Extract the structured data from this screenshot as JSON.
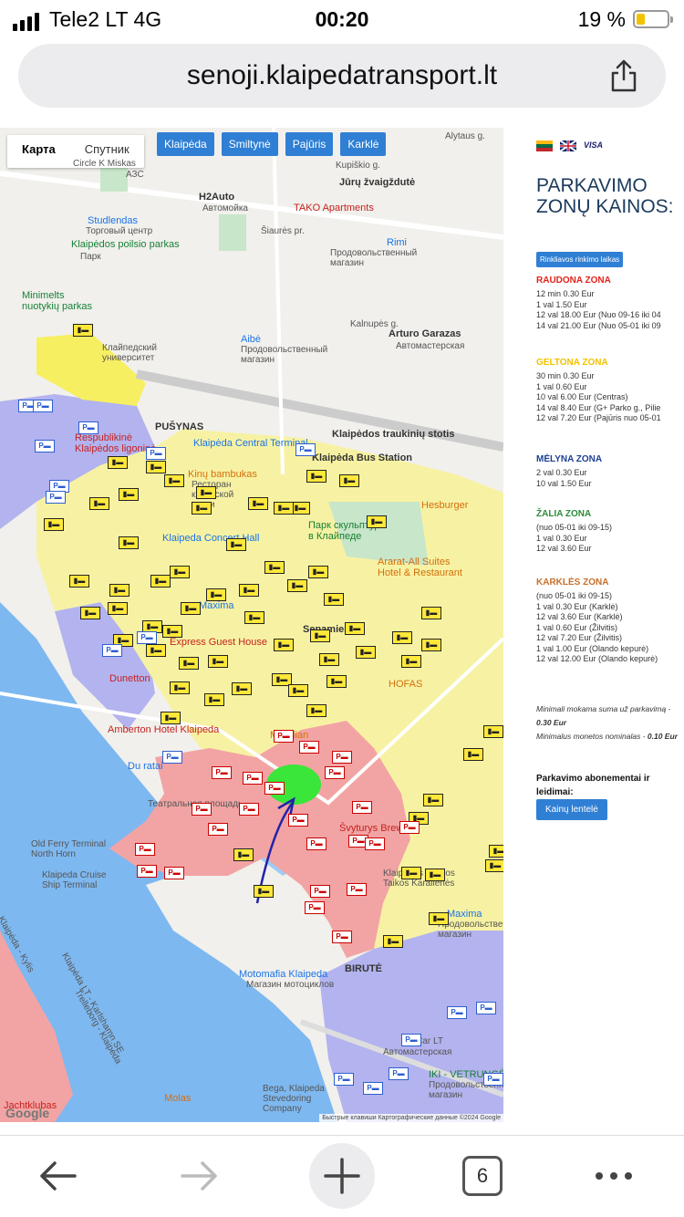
{
  "status": {
    "carrier": "Tele2 LT  4G",
    "time": "00:20",
    "battery": "19 %"
  },
  "browser": {
    "url": "senoji.klaipedatransport.lt",
    "tab_count": "6"
  },
  "map": {
    "map_type": [
      "Карта",
      "Спутник"
    ],
    "areas": [
      "Klaipėda",
      "Smiltynė",
      "Pajūris",
      "Karklė"
    ],
    "labels": {
      "alytaus": "Alytaus g.",
      "kupiskio": "Kupiškio g.",
      "circle": "Circle K Miskas",
      "azs": "АЗС",
      "jurys": "Jūrų žvaigždutė",
      "h2auto": "H2Auto",
      "h2auto_sub": "Автомойка",
      "tako": "TAKO Apartments",
      "siaures": "Šiaurės pr.",
      "studlendas": "Studlendas",
      "studlendas_sub": "Торговый центр",
      "rimi": "Rimi",
      "rimi_sub": "Продовольственный магазин",
      "poilsio": "Klaipėdos poilsio parkas",
      "poilsio_sub": "Парк",
      "minimelts": "Minimelts nuotykių parkas",
      "kalnupes": "Kalnupės g.",
      "arturo": "Arturo Garazas",
      "arturo_sub": "Автомастерская",
      "universitetas": "Клайпедский университет",
      "aibe": "Aibė",
      "aibe_sub": "Продовольственный магазин",
      "pusynas": "PUŠYNAS",
      "respublikine": "Respublikinė Klaipėdos ligoninė",
      "central": "Klaipėda Central Terminal",
      "stotis": "Klaipėdos traukinių stotis",
      "bus": "Klaipėda Bus Station",
      "bambukas": "Kinų bambukas",
      "bambukas_sub": "Ресторан китайской кухни",
      "hesburger": "Hesburger",
      "park": "Парк скульптур в Клайпеде",
      "concert": "Klaipeda Concert Hall",
      "ararat": "Ararat-All Suites Hotel & Restaurant",
      "maxima": "Maxima",
      "senamiestis": "Senamiestis",
      "express": "Express Guest House",
      "dunetton": "Dunetton",
      "amberton": "Amberton Hotel Klaipeda",
      "meridian": "Meridian",
      "hofas": "HOFAS",
      "duratai": "Du ratai",
      "teatro": "Театральная площадь",
      "svyturys": "Švyturys Brewery",
      "oldferry": "Old Ferry Terminal North Horn",
      "cruise": "Klaipeda Cruise Ship Terminal",
      "marijos": "Klaipėdos Marijos Taikos Karalienės",
      "maxima2": "Maxima",
      "maxima2_sub": "Продовольственный магазин",
      "motomafia": "Motomafia Klaipeda",
      "motomafia_sub": "Магазин мотоциклов",
      "birute": "BIRUTĖ",
      "luxcar": "LuxCar LT",
      "luxcar_sub": "Автомастерская",
      "iki": "IKI - VETRUNGĖ",
      "iki_sub": "Продовольственный магазин",
      "molas": "Molas",
      "bega": "Bega, Klaipeda Stevedoring Company",
      "jachtklubas": "Jachtklubas",
      "kylis": "Klaipėda - Kylis",
      "karlshamn": "Klaipėda LT - Karlshamn SE",
      "trelleborg": "Trelleborg - Klaipėda"
    },
    "attribution": "Быстрые клавиши   Картографические данные ©2024 Google",
    "google": "Google"
  },
  "sidebar": {
    "visa": "VISA",
    "title": "PARKAVIMO ZONŲ KAINOS:",
    "collect_btn": "Rinkliavos rinkimo laikas",
    "zones": [
      {
        "name": "RAUDONA ZONA",
        "color": "#e2231a",
        "rows": [
          "12 min   0.30 Eur",
          "  1 val     1.50 Eur",
          "12 val     18.00 Eur (Nuo 09-16 iki 04",
          "14 val     21.00 Eur (Nuo 05-01 iki 09"
        ]
      },
      {
        "name": "GELTONA ZONA",
        "color": "#f2c200",
        "rows": [
          "30 min   0.30 Eur",
          "  1 val     0.60 Eur",
          "10 val     6.00 Eur (Centras)",
          "14 val     8.40 Eur (G+ Parko g., Pilie",
          "12 val     7.20 Eur (Pajūris nuo 05-01"
        ]
      },
      {
        "name": "MĖLYNA ZONA",
        "color": "#1c3f94",
        "rows": [
          "  2 val     0.30 Eur",
          "10 val     1.50 Eur"
        ]
      },
      {
        "name": "ŽALIA ZONA",
        "color": "#2e8b3a",
        "rows": [
          "(nuo 05-01 iki 09-15)",
          "  1 val     0.30 Eur",
          "12 val     3.60 Eur"
        ]
      },
      {
        "name": "KARKLĖS ZONA",
        "color": "#c8702a",
        "rows": [
          "(nuo 05-01 iki 09-15)",
          "  1 val   0.30 Eur (Karklė)",
          "12 val   3.60 Eur (Karklė)",
          "  1 val   0.60 Eur (Žilvitis)",
          "12 val   7.20 Eur (Žilvitis)",
          "  1 val   1.00 Eur (Olando kepurė)",
          "12 val  12.00 Eur (Olando kepurė)"
        ]
      }
    ],
    "min_sum_label": "Minimali mokama suma už parkavimą - ",
    "min_sum_value": "0.30 Eur",
    "min_coin_label": "Minimalus monetos nominalas - ",
    "min_coin_value": "0.10 Eur",
    "abon": "Parkavimo abonementai ir leidimai:",
    "kainu_btn": "Kainų lentelė"
  },
  "colors": {
    "accent": "#2f7fd4",
    "red_zone": "#f2a4a4",
    "yellow_zone": "#f7f2a3",
    "blue_zone": "#b3b3ef",
    "water": "#7eb8f0"
  }
}
